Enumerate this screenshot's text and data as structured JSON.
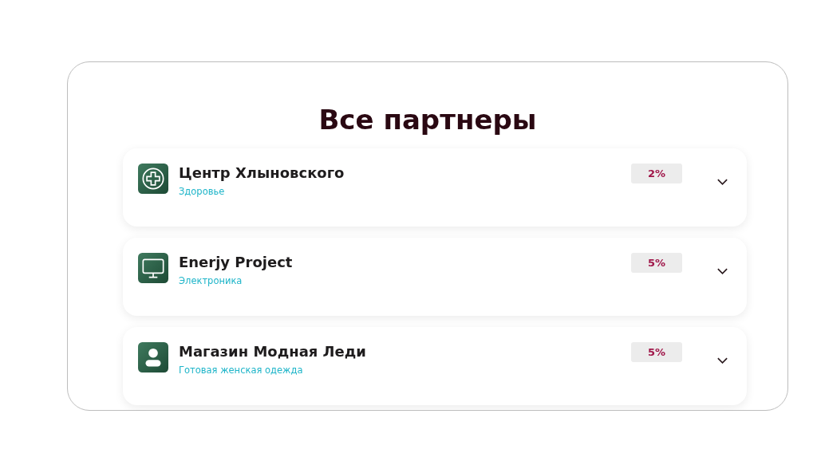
{
  "title": "Все партнеры",
  "partners": [
    {
      "name": "Центр Хлыновского",
      "category": "Здоровье",
      "discount": "2%",
      "expanded": false
    },
    {
      "name": "Enerjy Project",
      "category": "Электроника",
      "discount": "5%",
      "expanded": false
    },
    {
      "name": "Магазин Модная Леди",
      "category": "Готовая женская одежда",
      "discount": "5%",
      "expanded": false
    }
  ]
}
